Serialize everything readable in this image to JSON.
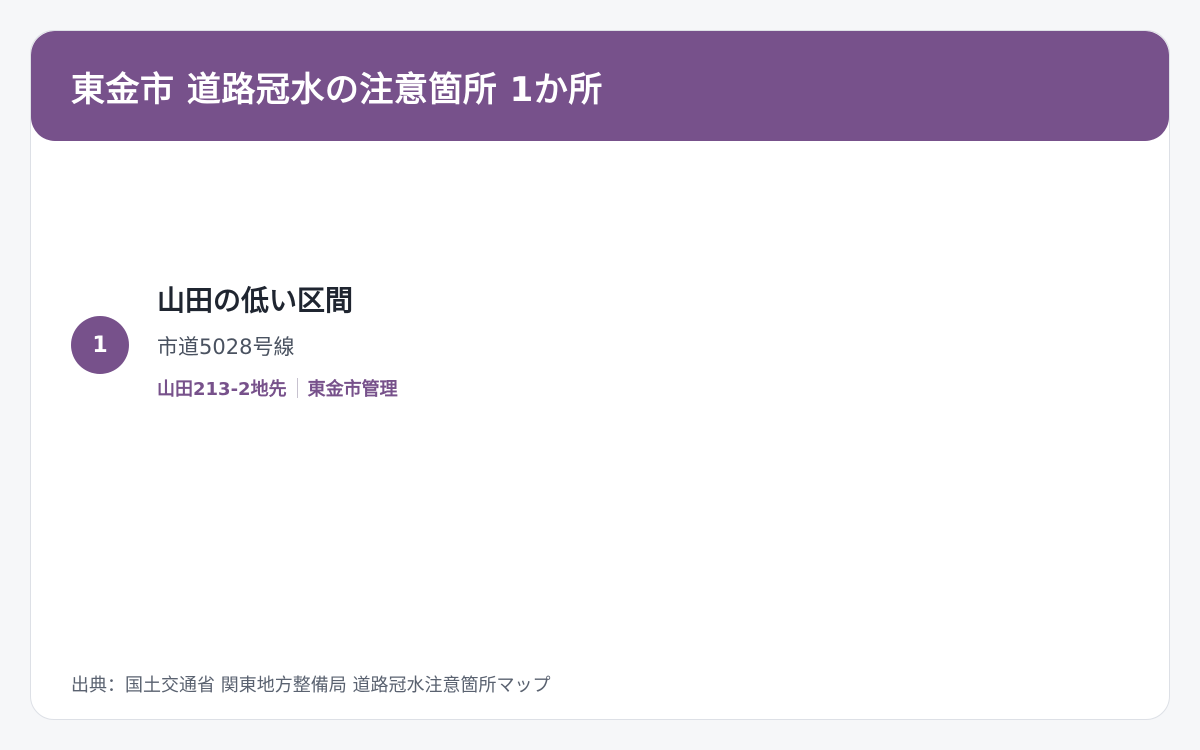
{
  "header": {
    "title": "東金市 道路冠水の注意箇所 1か所"
  },
  "items": [
    {
      "number": "1",
      "name": "山田の低い区間",
      "road": "市道5028号線",
      "location": "山田213-2地先",
      "manager": "東金市管理"
    }
  ],
  "footer": {
    "source": "出典：国土交通省 関東地方整備局 道路冠水注意箇所マップ"
  },
  "colors": {
    "accent": "#77518b",
    "background": "#f6f7f9",
    "card": "#ffffff",
    "title_text": "#1f2530",
    "body_text": "#4a5260"
  }
}
